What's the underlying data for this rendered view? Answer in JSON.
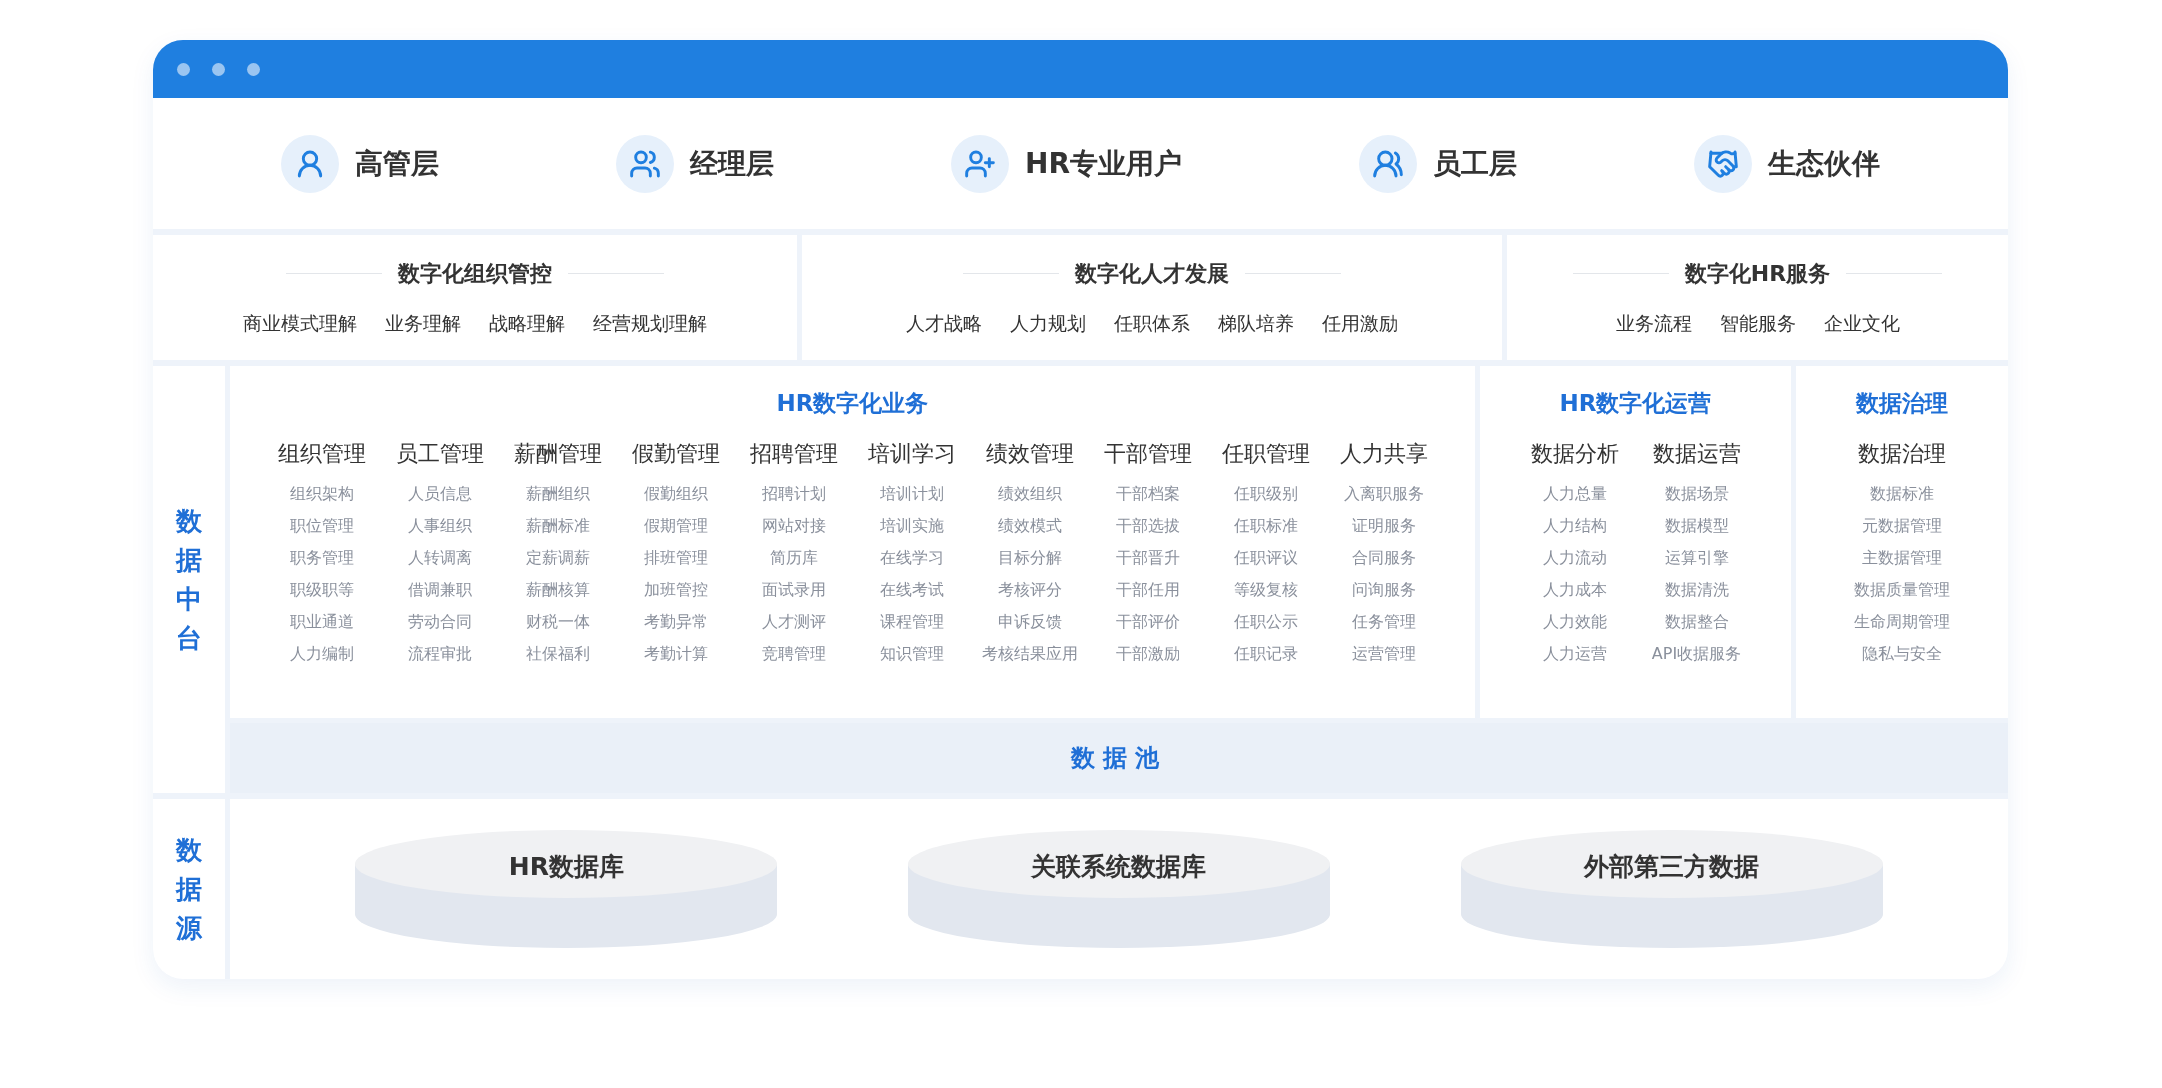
{
  "users": [
    {
      "label": "高管层"
    },
    {
      "label": "经理层"
    },
    {
      "label": "HR专业用户"
    },
    {
      "label": "员工层"
    },
    {
      "label": "生态伙伴"
    }
  ],
  "sections": [
    {
      "title": "数字化组织管控",
      "items": [
        "商业模式理解",
        "业务理解",
        "战略理解",
        "经营规划理解"
      ]
    },
    {
      "title": "数字化人才发展",
      "items": [
        "人才战略",
        "人力规划",
        "任职体系",
        "梯队培养",
        "任用激励"
      ]
    },
    {
      "title": "数字化HR服务",
      "items": [
        "业务流程",
        "智能服务",
        "企业文化"
      ]
    }
  ],
  "data_platform": {
    "label": "数据中台",
    "business": {
      "title": "HR数字化业务",
      "columns": [
        {
          "heading": "组织管理",
          "items": [
            "组织架构",
            "职位管理",
            "职务管理",
            "职级职等",
            "职业通道",
            "人力编制"
          ]
        },
        {
          "heading": "员工管理",
          "items": [
            "人员信息",
            "人事组织",
            "人转调离",
            "借调兼职",
            "劳动合同",
            "流程审批"
          ]
        },
        {
          "heading": "薪酬管理",
          "items": [
            "薪酬组织",
            "薪酬标准",
            "定薪调薪",
            "薪酬核算",
            "财税一体",
            "社保福利"
          ]
        },
        {
          "heading": "假勤管理",
          "items": [
            "假勤组织",
            "假期管理",
            "排班管理",
            "加班管控",
            "考勤异常",
            "考勤计算"
          ]
        },
        {
          "heading": "招聘管理",
          "items": [
            "招聘计划",
            "网站对接",
            "简历库",
            "面试录用",
            "人才测评",
            "竞聘管理"
          ]
        },
        {
          "heading": "培训学习",
          "items": [
            "培训计划",
            "培训实施",
            "在线学习",
            "在线考试",
            "课程管理",
            "知识管理"
          ]
        },
        {
          "heading": "绩效管理",
          "items": [
            "绩效组织",
            "绩效模式",
            "目标分解",
            "考核评分",
            "申诉反馈",
            "考核结果应用"
          ]
        },
        {
          "heading": "干部管理",
          "items": [
            "干部档案",
            "干部选拔",
            "干部晋升",
            "干部任用",
            "干部评价",
            "干部激励"
          ]
        },
        {
          "heading": "任职管理",
          "items": [
            "任职级别",
            "任职标准",
            "任职评议",
            "等级复核",
            "任职公示",
            "任职记录"
          ]
        },
        {
          "heading": "人力共享",
          "items": [
            "入离职服务",
            "证明服务",
            "合同服务",
            "问询服务",
            "任务管理",
            "运营管理"
          ]
        }
      ]
    },
    "operations": {
      "title": "HR数字化运营",
      "columns": [
        {
          "heading": "数据分析",
          "items": [
            "人力总量",
            "人力结构",
            "人力流动",
            "人力成本",
            "人力效能",
            "人力运营"
          ]
        },
        {
          "heading": "数据运营",
          "items": [
            "数据场景",
            "数据模型",
            "运算引擎",
            "数据清洗",
            "数据整合",
            "API收据服务"
          ]
        }
      ]
    },
    "governance": {
      "title": "数据治理",
      "columns": [
        {
          "heading": "数据治理",
          "items": [
            "数据标准",
            "元数据管理",
            "主数据管理",
            "数据质量管理",
            "生命周期管理",
            "隐私与安全"
          ]
        }
      ]
    },
    "pool": "数据池"
  },
  "data_source": {
    "label": "数据源",
    "databases": [
      "HR数据库",
      "关联系统数据库",
      "外部第三方数据"
    ]
  }
}
